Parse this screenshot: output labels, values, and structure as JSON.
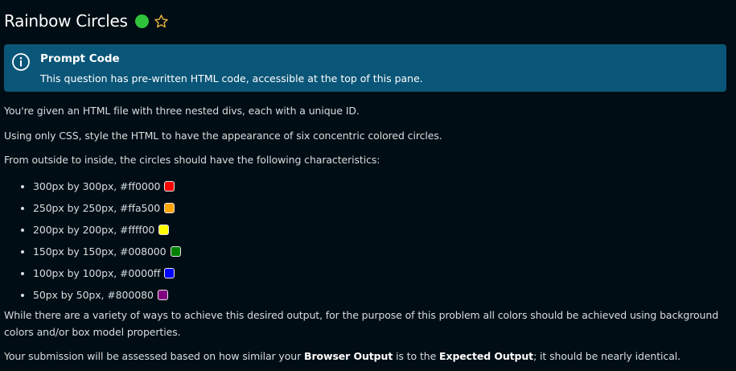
{
  "header": {
    "title": "Rainbow Circles",
    "status_color": "#2fc23a",
    "star_color": "#e8b43c"
  },
  "callout": {
    "title": "Prompt Code",
    "body": "This question has pre-written HTML code, accessible at the top of this pane.",
    "background": "#0a5678",
    "icon": "info-icon"
  },
  "content": {
    "p1": "You're given an HTML file with three nested divs, each with a unique ID.",
    "p2": "Using only CSS, style the HTML to have the appearance of six concentric colored circles.",
    "p3": "From outside to inside, the circles should have the following characteristics:",
    "circles": [
      {
        "text": "300px by 300px, #ff0000",
        "color": "#ff0000"
      },
      {
        "text": "250px by 250px, #ffa500",
        "color": "#ffa500"
      },
      {
        "text": "200px by 200px, #ffff00",
        "color": "#ffff00"
      },
      {
        "text": "150px by 150px, #008000",
        "color": "#008000"
      },
      {
        "text": "100px by 100px, #0000ff",
        "color": "#0000ff"
      },
      {
        "text": "50px by 50px, #800080",
        "color": "#800080"
      }
    ],
    "p4": "While there are a variety of ways to achieve this desired output, for the purpose of this problem all colors should be achieved using background colors and/or box model properties.",
    "p5_before": "Your submission will be assessed based on how similar your ",
    "p5_bold1": "Browser Output",
    "p5_middle": " is to the ",
    "p5_bold2": "Expected Output",
    "p5_after": "; it should be nearly identical."
  }
}
